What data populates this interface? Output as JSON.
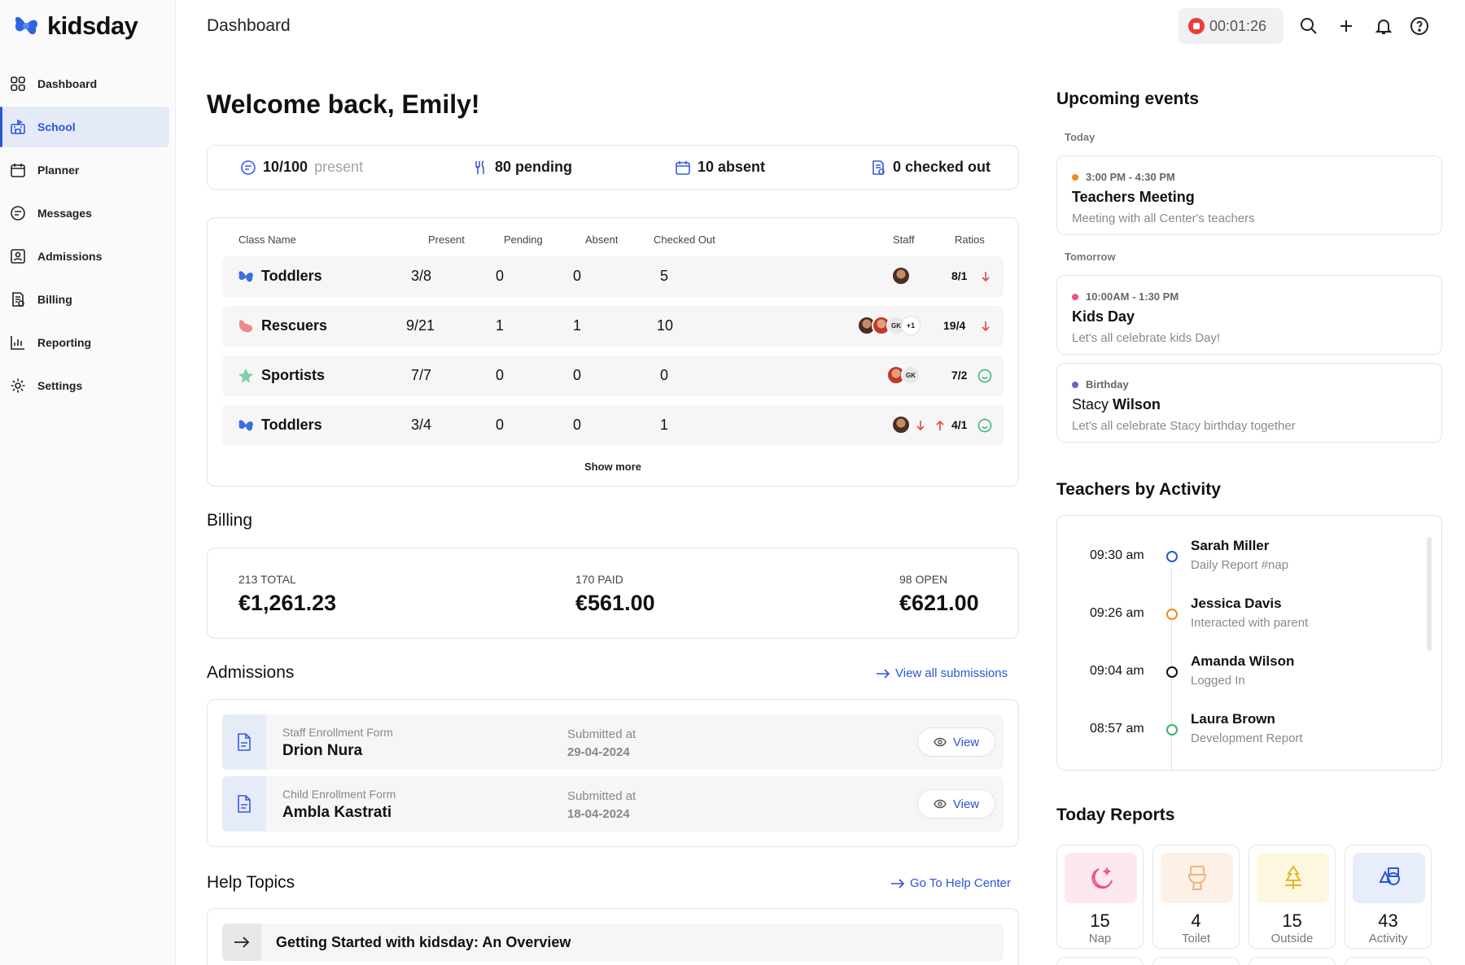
{
  "app": {
    "name": "kidsday",
    "brand_color": "#2b55d9"
  },
  "sidebar": {
    "items": [
      {
        "label": "Dashboard",
        "icon": "grid-icon",
        "active": false
      },
      {
        "label": "School",
        "icon": "school-icon",
        "active": true
      },
      {
        "label": "Planner",
        "icon": "calendar-icon",
        "active": false
      },
      {
        "label": "Messages",
        "icon": "message-icon",
        "active": false
      },
      {
        "label": "Admissions",
        "icon": "user-card-icon",
        "active": false
      },
      {
        "label": "Billing",
        "icon": "receipt-icon",
        "active": false
      },
      {
        "label": "Reporting",
        "icon": "bar-chart-icon",
        "active": false
      },
      {
        "label": "Settings",
        "icon": "gear-icon",
        "active": false
      }
    ]
  },
  "topbar": {
    "title": "Dashboard",
    "timer": "00:01:26"
  },
  "welcome": "Welcome back, Emily!",
  "stats": {
    "present_count": "10/100",
    "present_label": "present",
    "pending": "80 pending",
    "absent": "10 absent",
    "checked_out": "0 checked out"
  },
  "classes": {
    "headers": [
      "Class Name",
      "Present",
      "Pending",
      "Absent",
      "Checked Out",
      "Staff",
      "Ratios"
    ],
    "rows": [
      {
        "name": "Toddlers",
        "present": "3/8",
        "pending": "0",
        "absent": "0",
        "checked_out": "5",
        "ratio": "8/1",
        "trend": "down",
        "icon_color": "#3b6fe0"
      },
      {
        "name": "Rescuers",
        "present": "9/21",
        "pending": "1",
        "absent": "1",
        "checked_out": "10",
        "ratio": "19/4",
        "trend": "down",
        "icon_color": "#f08a8a"
      },
      {
        "name": "Sportists",
        "present": "7/7",
        "pending": "0",
        "absent": "0",
        "checked_out": "0",
        "ratio": "7/2",
        "trend": "ok",
        "icon_color": "#7fd0a8"
      },
      {
        "name": "Toddlers",
        "present": "3/4",
        "pending": "0",
        "absent": "0",
        "checked_out": "1",
        "ratio": "4/1",
        "trend": "ok",
        "icon_color": "#3b6fe0"
      }
    ],
    "staff_badges": {
      "gk": "GK",
      "more": "+1"
    },
    "show_more": "Show more"
  },
  "billing": {
    "title": "Billing",
    "total_label": "213 TOTAL",
    "total_value": "€1,261.23",
    "paid_label": "170 PAID",
    "paid_value": "€561.00",
    "open_label": "98 OPEN",
    "open_value": "€621.00"
  },
  "admissions": {
    "title": "Admissions",
    "view_all": "View all submissions",
    "submitted_label": "Submitted at",
    "view_label": "View",
    "items": [
      {
        "form": "Staff Enrollment Form",
        "name": "Drion Nura",
        "date": "29-04-2024"
      },
      {
        "form": "Child Enrollment Form",
        "name": "Ambla Kastrati",
        "date": "18-04-2024"
      }
    ]
  },
  "help": {
    "title": "Help Topics",
    "link": "Go To Help Center",
    "items": [
      "Getting Started with kidsday: An Overview"
    ]
  },
  "events": {
    "title": "Upcoming events",
    "today": "Today",
    "tomorrow": "Tomorrow",
    "items": [
      {
        "time": "3:00 PM - 4:30 PM",
        "title": "Teachers Meeting",
        "desc": "Meeting with all Center's teachers",
        "dot": "#f08a1c"
      },
      {
        "time": "10:00AM - 1:30 PM",
        "title": "Kids Day",
        "desc": "Let's all celebrate kids Day!",
        "dot": "#ee4f8a"
      },
      {
        "time": "Birthday",
        "title_light": "Stacy",
        "title_bold": "Wilson",
        "desc": "Let's all celebrate Stacy birthday together",
        "dot": "#7c5ac9"
      }
    ]
  },
  "activity": {
    "title": "Teachers by Activity",
    "items": [
      {
        "time": "09:30 am",
        "name": "Sarah Miller",
        "desc": "Daily Report #nap",
        "color": "#2b55d9"
      },
      {
        "time": "09:26 am",
        "name": "Jessica Davis",
        "desc": "Interacted with parent",
        "color": "#f08a1c"
      },
      {
        "time": "09:04 am",
        "name": "Amanda Wilson",
        "desc": "Logged In",
        "color": "#111111"
      },
      {
        "time": "08:57 am",
        "name": "Laura Brown",
        "desc": "Development Report",
        "color": "#3cb371"
      }
    ]
  },
  "reports": {
    "title": "Today Reports",
    "items": [
      {
        "value": "15",
        "label": "Nap",
        "bg": "#fde8f0",
        "color": "#ee4f8a"
      },
      {
        "value": "4",
        "label": "Toilet",
        "bg": "#fdf0e6",
        "color": "#f0b47a"
      },
      {
        "value": "15",
        "label": "Outside",
        "bg": "#fdf7e0",
        "color": "#e2b62a"
      },
      {
        "value": "43",
        "label": "Activity",
        "bg": "#e7edfb",
        "color": "#2b55d9"
      }
    ]
  }
}
